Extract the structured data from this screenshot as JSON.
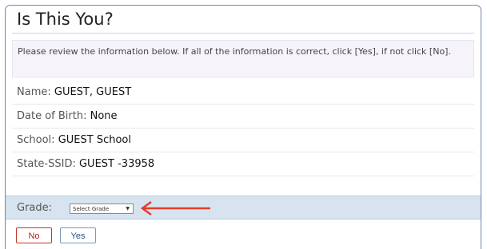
{
  "dialog": {
    "title": "Is This You?",
    "notice": "Please review the information below. If all of the information is correct, click [Yes], if not click [No]."
  },
  "fields": [
    {
      "label": "Name:",
      "value": "GUEST, GUEST"
    },
    {
      "label": "Date of Birth:",
      "value": "None"
    },
    {
      "label": "School:",
      "value": "GUEST School"
    },
    {
      "label": "State-SSID:",
      "value": "GUEST -33958"
    }
  ],
  "grade": {
    "label": "Grade:",
    "selected": "Select Grade"
  },
  "buttons": {
    "no": "No",
    "yes": "Yes"
  },
  "colors": {
    "accent_arrow": "#e53b2c",
    "grade_band": "#d7e4ef",
    "no_border": "#c0392b",
    "yes_border": "#7f97c0"
  },
  "icons": {
    "arrow": "arrow-left-icon",
    "dropdown": "chevron-down-icon"
  }
}
